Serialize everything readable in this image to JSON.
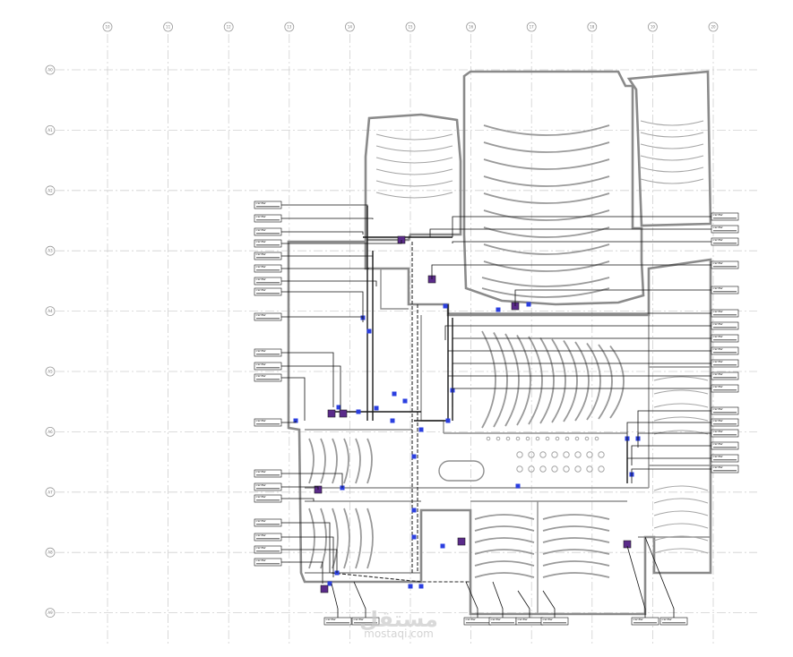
{
  "grid_columns": [
    "10",
    "11",
    "12",
    "13",
    "14",
    "15",
    "16",
    "17",
    "18",
    "19",
    "20"
  ],
  "grid_rows": [
    "A0",
    "A1",
    "A2",
    "A3",
    "A4",
    "A5",
    "A6",
    "A7",
    "A8",
    "A9"
  ],
  "watermark": {
    "brand": "مستقل",
    "site": "mostaqi.com"
  },
  "tags": {
    "left": [
      "CW BW",
      "CW BW",
      "CW BW",
      "CW BW",
      "CW BW",
      "CW BW",
      "CW BW",
      "CW BW",
      "CW BW",
      "CW BW",
      "CW BW",
      "CW BW",
      "CW BW",
      "CW BW",
      "CW BW",
      "CW BW",
      "CW BW",
      "CW BW",
      "CW BW",
      "CW BW"
    ],
    "right": [
      "CW BW",
      "CW BW",
      "CW BW",
      "CW BW",
      "CW BW",
      "CW BW",
      "CW BW",
      "CW BW",
      "CW BW",
      "CW BW",
      "CW BW",
      "CW BW",
      "CW BW",
      "CW BW",
      "CW BW",
      "CW BW",
      "CW BW",
      "CW BW"
    ],
    "bottom": [
      "CW BW",
      "CW BW",
      "CW BW",
      "CW BW",
      "CW BW",
      "CW BW",
      "CW BW",
      "CW BW"
    ]
  },
  "colors": {
    "fixture": "#2b3fe0",
    "equipment": "#5a2a8a",
    "walls": "#8a8a8a",
    "grid": "#d0d0d0"
  }
}
